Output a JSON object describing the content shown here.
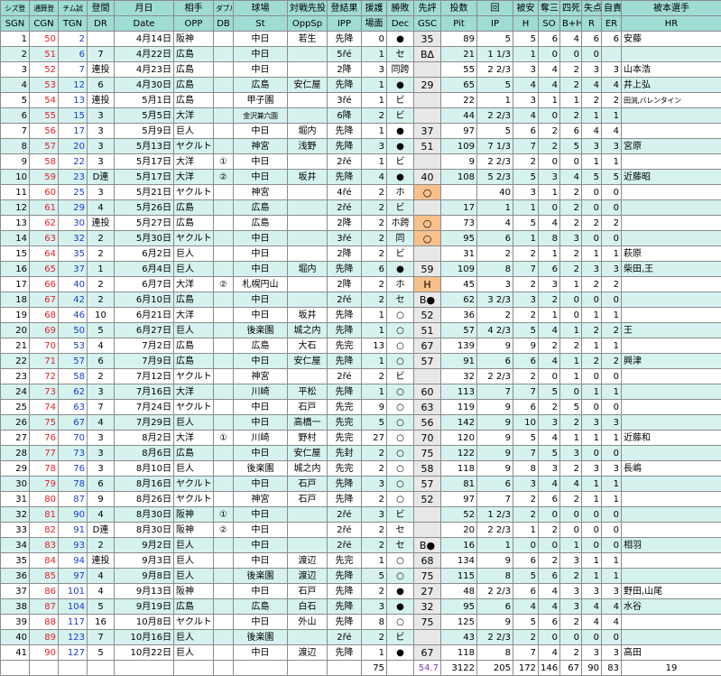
{
  "header_jp": [
    "シズ登",
    "通算登",
    "チム試",
    "登間",
    "月日",
    "相手",
    "ダブル",
    "球場",
    "対戦先投",
    "登結果",
    "援護",
    "勝敗",
    "先評",
    "投数",
    "回",
    "被安",
    "奪三",
    "四死",
    "失点",
    "自責",
    "被本選手"
  ],
  "header_en": [
    "SGN",
    "CGN",
    "TGN",
    "DR",
    "Date",
    "OPP",
    "DB",
    "St",
    "OppSp",
    "IPP",
    "場面",
    "Dec",
    "GSC",
    "Pit",
    "IP",
    "H",
    "SO",
    "B+H",
    "R",
    "ER",
    "HR"
  ],
  "rows": [
    [
      "1",
      "50",
      "2",
      "",
      "4月14日",
      "阪神",
      "",
      "中日",
      "若生",
      "先降",
      "0",
      "●",
      "35",
      "89",
      "5",
      "5",
      "6",
      "4",
      "6",
      "6",
      "安藤"
    ],
    [
      "2",
      "51",
      "6",
      "7",
      "4月22日",
      "広島",
      "",
      "中日",
      "",
      "5řé",
      "1",
      "セ",
      "BΔ",
      "21",
      "1 1/3",
      "1",
      "0",
      "0",
      "0",
      "",
      ""
    ],
    [
      "3",
      "52",
      "7",
      "連投",
      "4月23日",
      "広島",
      "",
      "中日",
      "",
      "2降",
      "3",
      "同跨",
      "",
      "55",
      "2 2/3",
      "3",
      "4",
      "2",
      "3",
      "3",
      "山本浩"
    ],
    [
      "4",
      "53",
      "12",
      "6",
      "4月30日",
      "広島",
      "",
      "広島",
      "安仁屋",
      "先降",
      "1",
      "●",
      "29",
      "65",
      "5",
      "4",
      "4",
      "2",
      "4",
      "4",
      "井上弘"
    ],
    [
      "5",
      "54",
      "13",
      "連投",
      "5月1日",
      "広島",
      "",
      "甲子園",
      "",
      "3řé",
      "1",
      "ビ",
      "",
      "22",
      "1",
      "3",
      "1",
      "1",
      "2",
      "2",
      "田渕,バレンタイン"
    ],
    [
      "6",
      "55",
      "15",
      "3",
      "5月5日",
      "大洋",
      "",
      "金沢兼六園",
      "",
      "6降",
      "2",
      "ビ",
      "",
      "44",
      "2 2/3",
      "4",
      "0",
      "2",
      "1",
      "1",
      ""
    ],
    [
      "7",
      "56",
      "17",
      "3",
      "5月9日",
      "巨人",
      "",
      "中日",
      "堀内",
      "先降",
      "1",
      "●",
      "37",
      "97",
      "5",
      "6",
      "2",
      "6",
      "4",
      "4",
      ""
    ],
    [
      "8",
      "57",
      "20",
      "3",
      "5月13日",
      "ヤクルト",
      "",
      "神宮",
      "浅野",
      "先降",
      "3",
      "●",
      "51",
      "109",
      "7 1/3",
      "7",
      "2",
      "5",
      "3",
      "3",
      "宮原"
    ],
    [
      "9",
      "58",
      "22",
      "3",
      "5月17日",
      "大洋",
      "①",
      "中日",
      "",
      "2řé",
      "1",
      "ビ",
      "",
      "9",
      "2 2/3",
      "2",
      "0",
      "0",
      "1",
      "1",
      ""
    ],
    [
      "10",
      "59",
      "23",
      "D連",
      "5月17日",
      "大洋",
      "②",
      "中日",
      "坂井",
      "先降",
      "4",
      "●",
      "40",
      "108",
      "5 2/3",
      "5",
      "3",
      "4",
      "5",
      "5",
      "近藤昭"
    ],
    [
      "11",
      "60",
      "25",
      "3",
      "5月21日",
      "ヤクルト",
      "",
      "神宮",
      "",
      "4řé",
      "2",
      "ホ",
      "○",
      "",
      "40",
      "3",
      "1",
      "2",
      "0",
      "0",
      ""
    ],
    [
      "12",
      "61",
      "29",
      "4",
      "5月26日",
      "広島",
      "",
      "広島",
      "",
      "2řé",
      "2",
      "ビ",
      "",
      "17",
      "1",
      "1",
      "0",
      "2",
      "0",
      "0",
      ""
    ],
    [
      "13",
      "62",
      "30",
      "連投",
      "5月27日",
      "広島",
      "",
      "広島",
      "",
      "2降",
      "2",
      "ホ跨",
      "○",
      "73",
      "4",
      "5",
      "4",
      "2",
      "2",
      "2",
      ""
    ],
    [
      "14",
      "63",
      "32",
      "2",
      "5月30日",
      "ヤクルト",
      "",
      "中日",
      "",
      "3řé",
      "2",
      "同",
      "○",
      "95",
      "6",
      "1",
      "8",
      "3",
      "0",
      "0",
      ""
    ],
    [
      "15",
      "64",
      "35",
      "2",
      "6月2日",
      "巨人",
      "",
      "中日",
      "",
      "2降",
      "2",
      "ビ",
      "",
      "31",
      "2",
      "2",
      "1",
      "2",
      "1",
      "1",
      "萩原"
    ],
    [
      "16",
      "65",
      "37",
      "1",
      "6月4日",
      "巨人",
      "",
      "中日",
      "堀内",
      "先降",
      "6",
      "●",
      "59",
      "109",
      "8",
      "7",
      "6",
      "2",
      "3",
      "3",
      "柴田,王"
    ],
    [
      "17",
      "66",
      "40",
      "2",
      "6月7日",
      "大洋",
      "②",
      "札幌円山",
      "",
      "2降",
      "2",
      "ホ",
      "H",
      "45",
      "3",
      "2",
      "3",
      "1",
      "2",
      "2",
      ""
    ],
    [
      "18",
      "67",
      "42",
      "2",
      "6月10日",
      "広島",
      "",
      "中日",
      "",
      "2řé",
      "2",
      "セ",
      "B●",
      "62",
      "3 2/3",
      "3",
      "2",
      "0",
      "0",
      "0",
      ""
    ],
    [
      "19",
      "68",
      "46",
      "10",
      "6月21日",
      "大洋",
      "",
      "中日",
      "坂井",
      "先降",
      "1",
      "○",
      "52",
      "36",
      "2",
      "2",
      "1",
      "0",
      "1",
      "1",
      ""
    ],
    [
      "20",
      "69",
      "50",
      "5",
      "6月27日",
      "巨人",
      "",
      "後楽園",
      "城之内",
      "先降",
      "1",
      "○",
      "51",
      "57",
      "4 2/3",
      "5",
      "4",
      "1",
      "2",
      "2",
      "王"
    ],
    [
      "21",
      "70",
      "53",
      "4",
      "7月2日",
      "広島",
      "",
      "広島",
      "大石",
      "先完",
      "13",
      "○",
      "67",
      "139",
      "9",
      "9",
      "2",
      "2",
      "1",
      "1",
      ""
    ],
    [
      "22",
      "71",
      "57",
      "6",
      "7月9日",
      "広島",
      "",
      "中日",
      "安仁屋",
      "先降",
      "1",
      "○",
      "57",
      "91",
      "6",
      "6",
      "4",
      "1",
      "2",
      "2",
      "興津"
    ],
    [
      "23",
      "72",
      "58",
      "2",
      "7月12日",
      "ヤクルト",
      "",
      "神宮",
      "",
      "2řé",
      "2",
      "ビ",
      "",
      "32",
      "2 2/3",
      "2",
      "0",
      "1",
      "0",
      "0",
      ""
    ],
    [
      "24",
      "73",
      "62",
      "3",
      "7月16日",
      "大洋",
      "",
      "川崎",
      "平松",
      "先降",
      "1",
      "○",
      "60",
      "113",
      "7",
      "7",
      "5",
      "0",
      "1",
      "1",
      ""
    ],
    [
      "25",
      "74",
      "63",
      "7",
      "7月24日",
      "ヤクルト",
      "",
      "中日",
      "石戸",
      "先完",
      "9",
      "○",
      "63",
      "119",
      "9",
      "6",
      "2",
      "5",
      "0",
      "0",
      ""
    ],
    [
      "26",
      "75",
      "67",
      "4",
      "7月29日",
      "巨人",
      "",
      "中日",
      "高橋一",
      "先完",
      "5",
      "○",
      "56",
      "142",
      "9",
      "10",
      "3",
      "2",
      "3",
      "3",
      ""
    ],
    [
      "27",
      "76",
      "70",
      "3",
      "8月2日",
      "大洋",
      "①",
      "川崎",
      "野村",
      "先完",
      "27",
      "○",
      "70",
      "120",
      "9",
      "5",
      "4",
      "1",
      "1",
      "1",
      "近藤和"
    ],
    [
      "28",
      "77",
      "73",
      "3",
      "8月6日",
      "広島",
      "",
      "中日",
      "安仁屋",
      "先封",
      "2",
      "○",
      "75",
      "122",
      "9",
      "7",
      "5",
      "3",
      "0",
      "0",
      ""
    ],
    [
      "29",
      "78",
      "76",
      "3",
      "8月10日",
      "巨人",
      "",
      "後楽園",
      "城之内",
      "先完",
      "2",
      "○",
      "58",
      "118",
      "9",
      "8",
      "3",
      "2",
      "3",
      "3",
      "長嶋"
    ],
    [
      "30",
      "79",
      "78",
      "6",
      "8月16日",
      "ヤクルト",
      "",
      "中日",
      "石戸",
      "先降",
      "3",
      "○",
      "57",
      "81",
      "6",
      "3",
      "4",
      "4",
      "1",
      "1",
      ""
    ],
    [
      "31",
      "80",
      "87",
      "9",
      "8月26日",
      "ヤクルト",
      "",
      "神宮",
      "石戸",
      "先降",
      "2",
      "○",
      "52",
      "97",
      "7",
      "2",
      "6",
      "2",
      "1",
      "1",
      ""
    ],
    [
      "32",
      "81",
      "90",
      "4",
      "8月30日",
      "阪神",
      "①",
      "中日",
      "",
      "2řé",
      "3",
      "ビ",
      "",
      "52",
      "1 2/3",
      "2",
      "0",
      "0",
      "0",
      "0",
      ""
    ],
    [
      "33",
      "82",
      "91",
      "D連",
      "8月30日",
      "阪神",
      "②",
      "中日",
      "",
      "2řé",
      "2",
      "セ",
      "",
      "20",
      "2 2/3",
      "1",
      "2",
      "0",
      "0",
      "0",
      ""
    ],
    [
      "34",
      "83",
      "93",
      "2",
      "9月2日",
      "巨人",
      "",
      "中日",
      "",
      "2řé",
      "2",
      "セ",
      "B●",
      "16",
      "1",
      "0",
      "0",
      "1",
      "0",
      "0",
      "相羽"
    ],
    [
      "35",
      "84",
      "94",
      "連投",
      "9月3日",
      "巨人",
      "",
      "中日",
      "渡辺",
      "先完",
      "1",
      "○",
      "68",
      "134",
      "9",
      "6",
      "2",
      "3",
      "1",
      "1",
      ""
    ],
    [
      "36",
      "85",
      "97",
      "4",
      "9月8日",
      "巨人",
      "",
      "後楽園",
      "渡辺",
      "先降",
      "5",
      "○",
      "75",
      "115",
      "8",
      "5",
      "6",
      "2",
      "1",
      "1",
      ""
    ],
    [
      "37",
      "86",
      "101",
      "4",
      "9月13日",
      "阪神",
      "",
      "中日",
      "石戸",
      "先降",
      "2",
      "●",
      "27",
      "48",
      "2 2/3",
      "6",
      "4",
      "3",
      "3",
      "3",
      "野田,山尾"
    ],
    [
      "38",
      "87",
      "104",
      "5",
      "9月19日",
      "広島",
      "",
      "広島",
      "白石",
      "先降",
      "3",
      "●",
      "32",
      "95",
      "6",
      "4",
      "4",
      "3",
      "4",
      "4",
      "水谷"
    ],
    [
      "39",
      "88",
      "117",
      "16",
      "10月8日",
      "ヤクルト",
      "",
      "中日",
      "外山",
      "先降",
      "8",
      "○",
      "75",
      "125",
      "9",
      "5",
      "6",
      "2",
      "4",
      "4",
      ""
    ],
    [
      "40",
      "89",
      "123",
      "7",
      "10月16日",
      "巨人",
      "",
      "後楽園",
      "",
      "2řé",
      "2",
      "ビ",
      "",
      "43",
      "2 2/3",
      "2",
      "0",
      "0",
      "0",
      "0",
      ""
    ],
    [
      "41",
      "90",
      "127",
      "5",
      "10月22日",
      "巨人",
      "",
      "中日",
      "渡辺",
      "先降",
      "1",
      "●",
      "67",
      "118",
      "8",
      "7",
      "4",
      "2",
      "3",
      "3",
      "高田"
    ]
  ],
  "totals": {
    "support": "75",
    "gsc": "54.7",
    "pit": "3122",
    "ip": "205",
    "h": "172",
    "so": "146",
    "bb": "67",
    "r": "90",
    "er": "83",
    "hr": "19"
  }
}
